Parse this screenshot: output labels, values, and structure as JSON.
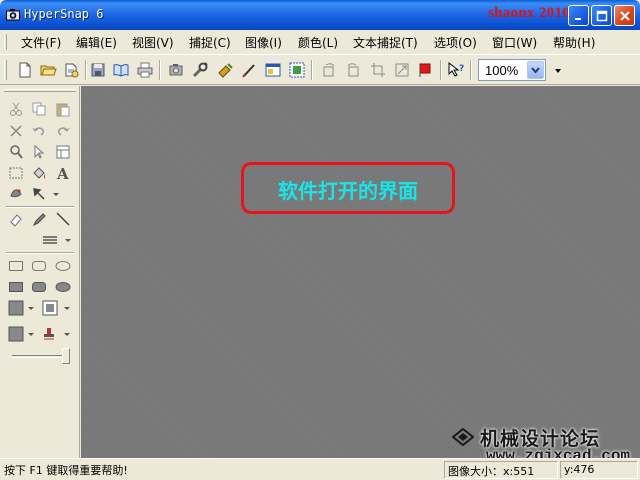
{
  "window": {
    "title": "HyperSnap 6",
    "watermark": "shaonx 2010-1-16",
    "controls": [
      "minimize",
      "maximize",
      "close"
    ]
  },
  "menu": {
    "items": [
      {
        "label": "文件(F)"
      },
      {
        "label": "编辑(E)"
      },
      {
        "label": "视图(V)"
      },
      {
        "label": "捕捉(C)"
      },
      {
        "label": "图像(I)"
      },
      {
        "label": "颜色(L)"
      },
      {
        "label": "文本捕捉(T)"
      },
      {
        "label": "选项(O)"
      },
      {
        "label": "窗口(W)"
      },
      {
        "label": "帮助(H)"
      }
    ]
  },
  "toolbar": {
    "buttons": [
      "new-icon",
      "open-icon",
      "open-folder-icon",
      "save-icon",
      "book-icon",
      "print-icon",
      "capture-region-icon",
      "tools-icon",
      "paint-icon",
      "pen-icon",
      "capture-window-icon",
      "capture-full-icon",
      "rotate-icon",
      "flip-icon",
      "crop-icon",
      "resize-icon",
      "flag-icon",
      "help-pointer-icon"
    ],
    "zoom": {
      "value": "100%"
    }
  },
  "palette": {
    "tools": [
      "cut-icon",
      "copy-icon",
      "paste-icon",
      "delete-icon",
      "undo-icon",
      "redo-icon",
      "zoom-icon",
      "select-icon",
      "window-icon",
      "rect-select-icon",
      "fill-icon",
      "text-icon",
      "stamp-icon",
      "arrow-icon",
      "eraser-icon",
      "pencil-icon",
      "line-icon",
      "line-style-icon",
      "rect-icon",
      "rounded-rect-icon",
      "ellipse-icon",
      "filled-rect-icon",
      "filled-rounded-rect-icon",
      "filled-ellipse-icon",
      "fg-color-icon",
      "bg-color-icon",
      "color-swatch-icon",
      "stamp-tool-icon",
      "width-slider-icon"
    ]
  },
  "canvas": {
    "annotation": "软件打开的界面",
    "forum_name": "机械设计论坛",
    "forum_url": "www.zgjxcad.com"
  },
  "status": {
    "hint": "按下 F1 键取得重要帮助!",
    "image_size_label": "图像大小：x:",
    "image_width": "551",
    "image_height_label": "y:",
    "image_height": "476"
  },
  "colors": {
    "titlebar": "#0a5fd8",
    "annotation_border": "#e6141e",
    "annotation_text": "#16e6ea",
    "canvas": "#7b7b7b"
  }
}
